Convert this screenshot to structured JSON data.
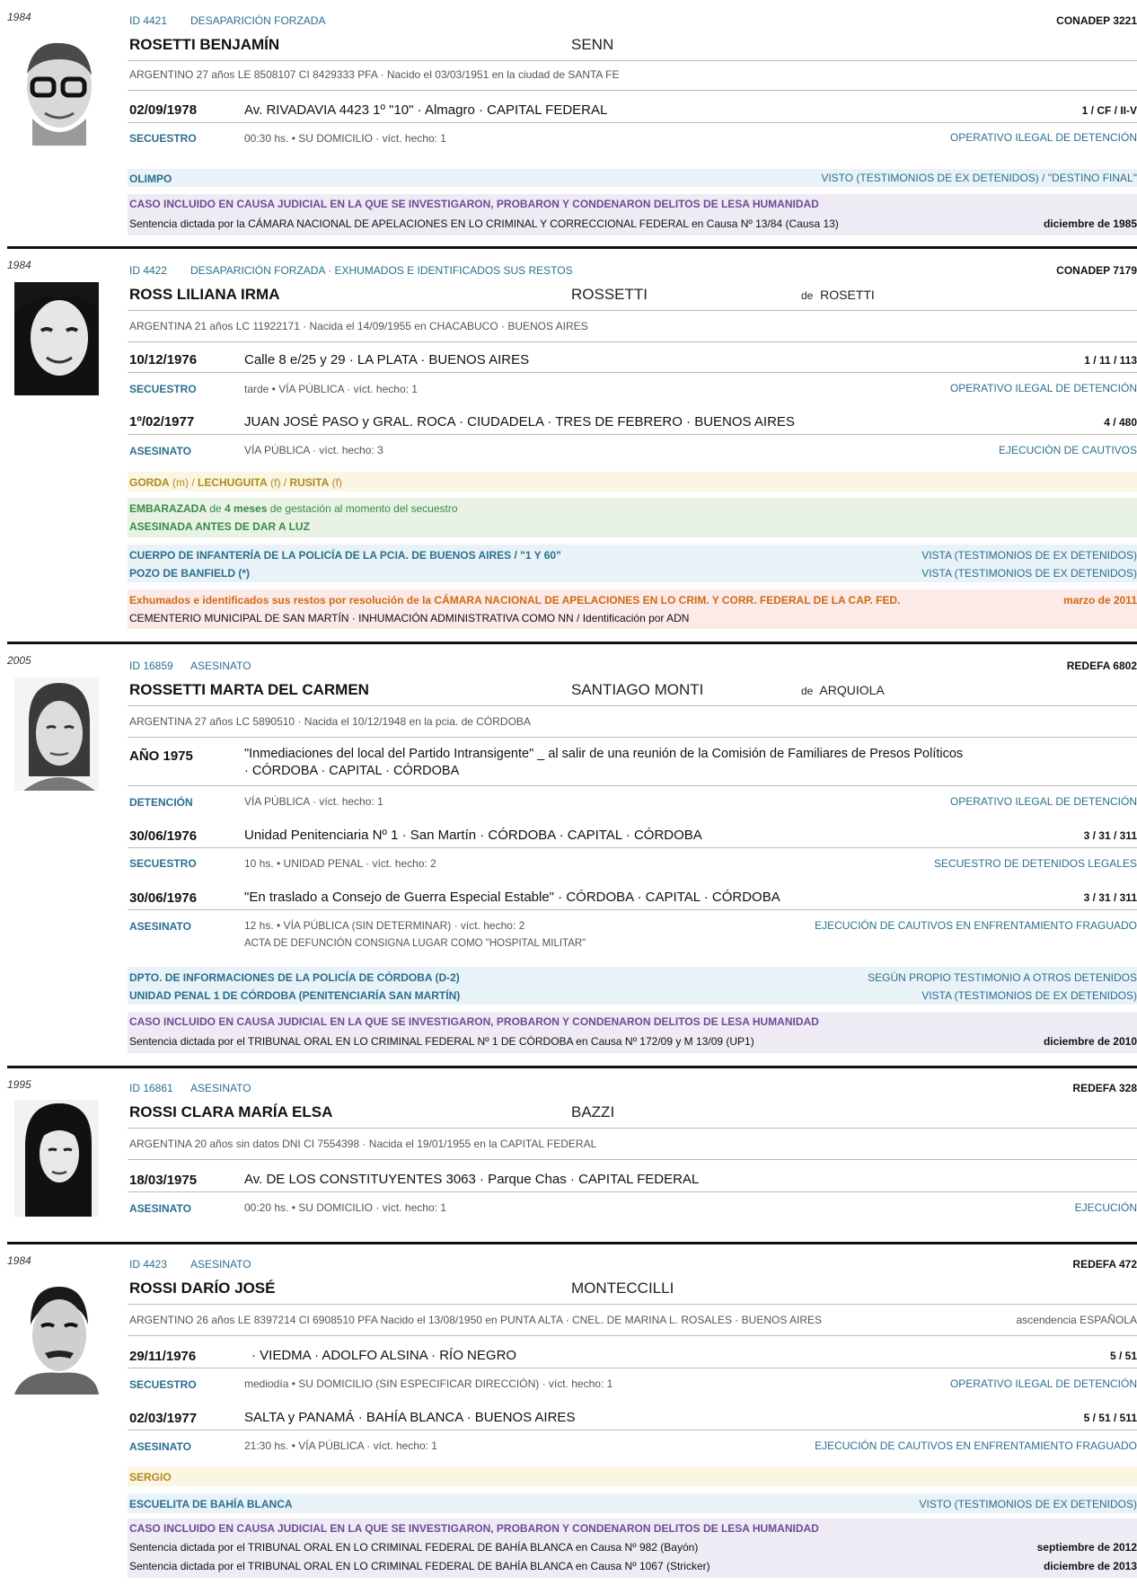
{
  "records": [
    {
      "year": "1984",
      "header": {
        "id": "ID 4421",
        "type": "DESAPARICIÓN FORZADA",
        "source": "CONADEP  3221"
      },
      "name": "ROSETTI  BENJAMÍN",
      "alias_surname": "SENN",
      "info": "ARGENTINO   27 años   LE 8508107   CI 8429333 PFA  ·  Nacido el 03/03/1951 en la ciudad de SANTA FE",
      "events": [
        {
          "date": "02/09/1978",
          "place": "Av. RIVADAVIA 4423  1º \"10\"  ·  Almagro  ·  CAPITAL FEDERAL",
          "ref": "1 / CF / II-V",
          "label": "SECUESTRO",
          "detail": "00:30 hs.  •  SU DOMICILIO  ·  víct. hecho: 1",
          "class": "OPERATIVO ILEGAL DE DETENCIÓN"
        }
      ],
      "centro": {
        "name": "OLIMPO",
        "note": "VISTO (TESTIMONIOS DE EX DETENIDOS) / \"DESTINO FINAL\""
      },
      "causa": {
        "title": "CASO INCLUIDO EN CAUSA JUDICIAL EN LA QUE SE INVESTIGARON, PROBARON Y CONDENARON DELITOS DE LESA HUMANIDAD",
        "lines": [
          {
            "text": "Sentencia dictada por la CÁMARA NACIONAL DE APELACIONES EN LO CRIMINAL Y CORRECCIONAL FEDERAL en Causa Nº 13/84 (Causa 13)",
            "date": "diciembre de 1985"
          }
        ]
      }
    },
    {
      "year": "1984",
      "header": {
        "id": "ID 4422",
        "type": "DESAPARICIÓN FORZADA  ·  EXHUMADOS E IDENTIFICADOS SUS RESTOS",
        "source": "CONADEP  7179"
      },
      "name": "ROSS  LILIANA IRMA",
      "alias_surname": "ROSSETTI",
      "married_prefix": "de",
      "married": "ROSETTI",
      "info": "ARGENTINA   21 años   LC 11922171  ·  Nacida el 14/09/1955 en CHACABUCO · BUENOS AIRES",
      "events": [
        {
          "date": "10/12/1976",
          "place": "Calle 8 e/25 y 29   ·   LA PLATA · BUENOS AIRES",
          "ref": "1 / 11 / 113",
          "label": "SECUESTRO",
          "detail": "tarde  •  VÍA PÚBLICA  ·  víct. hecho: 1",
          "class": "OPERATIVO ILEGAL DE DETENCIÓN"
        },
        {
          "date": "1º/02/1977",
          "place": "JUAN JOSÉ PASO y GRAL. ROCA   ·   CIUDADELA · TRES DE FEBRERO · BUENOS AIRES",
          "ref": "4 / 480",
          "label": "ASESINATO",
          "detail": "VÍA PÚBLICA  ·  víct. hecho: 3",
          "class": "EJECUCIÓN DE CAUTIVOS"
        }
      ],
      "apodos": {
        "a1": "GORDA",
        "a1s": " (m) / ",
        "a2": "LECHUGUITA",
        "a2s": " (f) / ",
        "a3": "RUSITA",
        "a3s": " (f)"
      },
      "embarazo": {
        "w1": "EMBARAZADA",
        "w2": " de ",
        "w3": "4 meses",
        "w4": " de gestación al momento del secuestro",
        "line2": "ASESINADA ANTES DE DAR A LUZ"
      },
      "centros": [
        {
          "name": "CUERPO DE INFANTERÍA DE LA POLICÍA DE LA PCIA. DE BUENOS AIRES / \"1 Y 60\"",
          "note": "VISTA (TESTIMONIOS DE EX DETENIDOS)"
        },
        {
          "name": "POZO DE BANFIELD (*)",
          "note": "VISTA (TESTIMONIOS DE EX DETENIDOS)"
        }
      ],
      "exhum": {
        "line1": "Exhumados e identificados sus restos por resolución de la CÁMARA NACIONAL DE APELACIONES EN LO CRIM. Y CORR. FEDERAL DE LA CAP. FED.",
        "date": "marzo de 2011",
        "line2": "CEMENTERIO MUNICIPAL DE SAN MARTÍN · INHUMACIÓN ADMINISTRATIVA COMO NN  /  Identificación por ADN"
      }
    },
    {
      "year": "2005",
      "header": {
        "id": "ID 16859",
        "type": "ASESINATO",
        "source": "REDEFA  6802"
      },
      "name": "ROSSETTI  MARTA DEL CARMEN",
      "alias_surname": "SANTIAGO MONTI",
      "married_prefix": "de",
      "married": "ARQUIOLA",
      "info": "ARGENTINA   27 años   LC 5890510  ·  Nacida el 10/12/1948 en la pcia. de CÓRDOBA",
      "events": [
        {
          "date": "AÑO 1975",
          "place": "\"Inmediaciones del local del Partido Intransigente\" _ al salir de una reunión de la Comisión de Familiares de Presos Políticos",
          "place2": "·   CÓRDOBA · CAPITAL · CÓRDOBA",
          "ref": "",
          "label": "DETENCIÓN",
          "detail": "VÍA PÚBLICA  ·  víct. hecho: 1",
          "class": "OPERATIVO ILEGAL DE DETENCIÓN"
        },
        {
          "date": "30/06/1976",
          "place": "Unidad Penitenciaria Nº 1  ·  San Martín  ·  CÓRDOBA · CAPITAL · CÓRDOBA",
          "ref": "3 / 31 / 311",
          "label": "SECUESTRO",
          "detail": "10 hs.  •  UNIDAD PENAL  ·  víct. hecho: 2",
          "class": "SECUESTRO DE DETENIDOS LEGALES"
        },
        {
          "date": "30/06/1976",
          "place": "\"En traslado a Consejo de Guerra Especial Estable\"   ·   CÓRDOBA · CAPITAL · CÓRDOBA",
          "ref": "3 / 31 / 311",
          "label": "ASESINATO",
          "detail": "12 hs.  •  VÍA PÚBLICA (SIN DETERMINAR)  ·  víct. hecho: 2",
          "detail2": "ACTA DE DEFUNCIÓN CONSIGNA LUGAR COMO \"HOSPITAL MILITAR\"",
          "class": "EJECUCIÓN DE CAUTIVOS EN ENFRENTAMIENTO FRAGUADO"
        }
      ],
      "centros": [
        {
          "name": "DPTO. DE INFORMACIONES DE LA POLICÍA DE CÓRDOBA (D-2)",
          "note": "SEGÚN PROPIO TESTIMONIO A OTROS DETENIDOS"
        },
        {
          "name": "UNIDAD PENAL 1 DE CÓRDOBA (PENITENCIARÍA SAN MARTÍN)",
          "note": "VISTA (TESTIMONIOS DE EX DETENIDOS)"
        }
      ],
      "causa": {
        "title": "CASO INCLUIDO EN CAUSA JUDICIAL EN LA QUE SE INVESTIGARON, PROBARON Y CONDENARON DELITOS DE LESA HUMANIDAD",
        "lines": [
          {
            "text": "Sentencia dictada por el TRIBUNAL ORAL EN LO CRIMINAL FEDERAL Nº 1 DE CÓRDOBA en Causa Nº 172/09 y M 13/09 (UP1)",
            "date": "diciembre de 2010"
          }
        ]
      }
    },
    {
      "year": "1995",
      "header": {
        "id": "ID 16861",
        "type": "ASESINATO",
        "source": "REDEFA  328"
      },
      "name": "ROSSI  CLARA MARÍA ELSA",
      "alias_surname": "BAZZI",
      "info": "ARGENTINA   20 años   sin datos DNI   CI 7554398  ·  Nacida el 19/01/1955 en la CAPITAL FEDERAL",
      "events": [
        {
          "date": "18/03/1975",
          "place": "Av. DE LOS CONSTITUYENTES 3063  ·  Parque Chas  ·  CAPITAL FEDERAL",
          "ref": "",
          "label": "ASESINATO",
          "detail": "00:20 hs.  •  SU DOMICILIO  ·  víct. hecho: 1",
          "class": "EJECUCIÓN"
        }
      ]
    },
    {
      "year": "1984",
      "header": {
        "id": "ID 4423",
        "type": "ASESINATO",
        "source": "REDEFA  472"
      },
      "name": "ROSSI  DARÍO JOSÉ",
      "alias_surname": "MONTECCILLI",
      "info": "ARGENTINO   26 años   LE 8397214   CI 6908510 PFA   Nacido el 13/08/1950 en PUNTA ALTA · CNEL. DE MARINA L. ROSALES · BUENOS AIRES",
      "ascendencia": "ascendencia ESPAÑOLA",
      "events": [
        {
          "date": "29/11/1976",
          "place": "·  VIEDMA · ADOLFO ALSINA · RÍO NEGRO",
          "ref": "5 / 51",
          "label": "SECUESTRO",
          "detail": "mediodía  •  SU DOMICILIO (SIN ESPECIFICAR DIRECCIÓN)  ·  víct. hecho: 1",
          "class": "OPERATIVO ILEGAL DE DETENCIÓN"
        },
        {
          "date": "02/03/1977",
          "place": "SALTA y PANAMÁ   ·   BAHÍA BLANCA · BUENOS AIRES",
          "ref": "5 / 51 / 511",
          "label": "ASESINATO",
          "detail": "21:30 hs.  •  VÍA PÚBLICA  ·  víct. hecho: 1",
          "class": "EJECUCIÓN DE CAUTIVOS EN ENFRENTAMIENTO FRAGUADO"
        }
      ],
      "apodo": "SERGIO",
      "centro": {
        "name": "ESCUELITA DE BAHÍA BLANCA",
        "note": "VISTO (TESTIMONIOS DE EX DETENIDOS)"
      },
      "causa": {
        "title": "CASO INCLUIDO EN CAUSA JUDICIAL EN LA QUE SE INVESTIGARON, PROBARON Y CONDENARON DELITOS DE LESA HUMANIDAD",
        "lines": [
          {
            "text": "Sentencia dictada por el TRIBUNAL ORAL EN LO CRIMINAL FEDERAL DE BAHÍA BLANCA en Causa Nº 982 (Bayón)",
            "date": "septiembre de 2012"
          },
          {
            "text": "Sentencia dictada por el TRIBUNAL ORAL EN LO CRIMINAL FEDERAL DE BAHÍA BLANCA en Causa Nº 1067 (Stricker)",
            "date": "diciembre de 2013"
          }
        ]
      }
    }
  ]
}
